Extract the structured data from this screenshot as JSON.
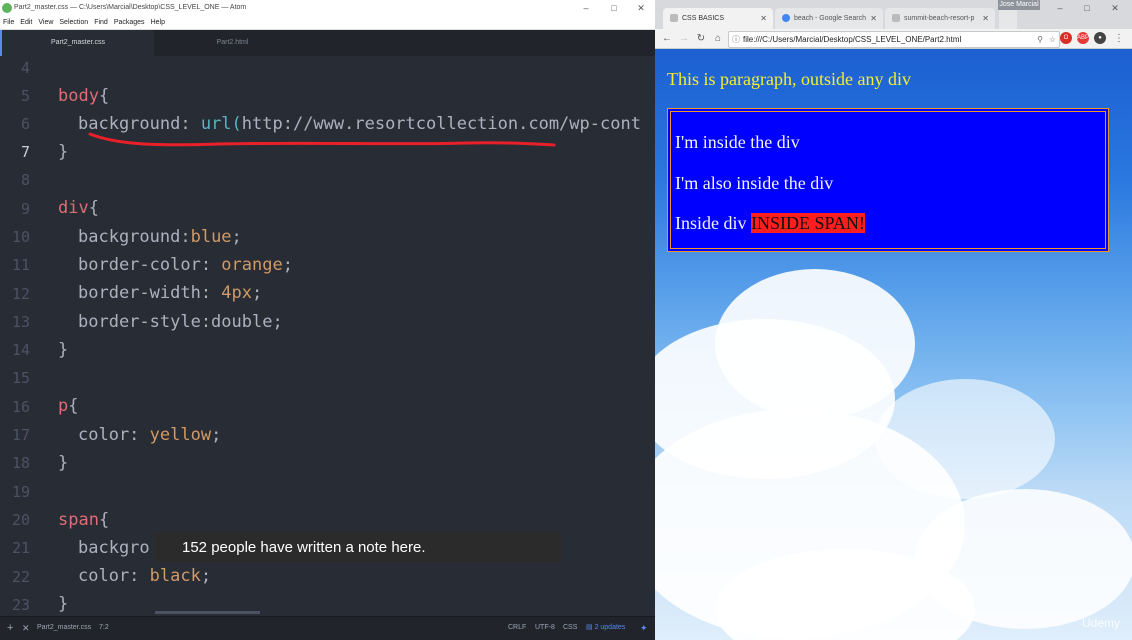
{
  "atom": {
    "title": "Part2_master.css — C:\\Users\\Marcial\\Desktop\\CSS_LEVEL_ONE — Atom",
    "menu": [
      "File",
      "Edit",
      "View",
      "Selection",
      "Find",
      "Packages",
      "Help"
    ],
    "tabs": [
      {
        "label": "Part2_master.css",
        "active": true
      },
      {
        "label": "Part2.html",
        "active": false
      }
    ],
    "line_numbers": [
      "4",
      "5",
      "6",
      "7",
      "8",
      "9",
      "10",
      "11",
      "12",
      "13",
      "14",
      "15",
      "16",
      "17",
      "18",
      "19",
      "20",
      "21",
      "22",
      "23"
    ],
    "current_line": "7",
    "code": {
      "l5_sel": "body",
      "l5_brace": "{",
      "l6_prop": "background: ",
      "l6_fn": "url(",
      "l6_str": "http://www.resortcollection.com/wp-cont",
      "l7": "}",
      "l9_sel": "div",
      "l9_brace": "{",
      "l10_prop": "background:",
      "l10_val": "blue",
      "l10_end": ";",
      "l11_prop": "border-color: ",
      "l11_val": "orange",
      "l11_end": ";",
      "l12_prop": "border-width: ",
      "l12_val": "4px",
      "l12_end": ";",
      "l13_prop": "border-style:double;",
      "l14": "}",
      "l16_sel": "p",
      "l16_brace": "{",
      "l17_prop": "color: ",
      "l17_val": "yellow",
      "l17_end": ";",
      "l18": "}",
      "l20_sel": "span",
      "l20_brace": "{",
      "l21_prop": "backgro",
      "l22_prop": "color: ",
      "l22_val": "black",
      "l22_end": ";",
      "l23": "}"
    },
    "tooltip": "152 people have written a note here.",
    "status": {
      "file": "Part2_master.css",
      "cursor": "7:2",
      "line_ending": "CRLF",
      "encoding": "UTF-8",
      "grammar": "CSS",
      "updates": "2 updates"
    },
    "colors": {
      "selector": "#e06c75",
      "value": "#d19a66",
      "function": "#56b6c2",
      "annotation": "#e8202a"
    }
  },
  "chrome": {
    "tabs": [
      {
        "label": "CSS BASICS",
        "active": true
      },
      {
        "label": "beach - Google Search",
        "active": false
      },
      {
        "label": "summit-beach-resort-p",
        "active": false
      }
    ],
    "user": "Jose Marcial",
    "url": "file:///C:/Users/Marcial/Desktop/CSS_LEVEL_ONE/Part2.html",
    "page": {
      "p_outside": "This is paragraph, outside any div",
      "div_p1": "I'm inside the div",
      "div_p2": "I'm also inside the div",
      "div_p3_text": "Inside div ",
      "span_text": "INSIDE SPAN!"
    },
    "watermark": "Udemy"
  }
}
